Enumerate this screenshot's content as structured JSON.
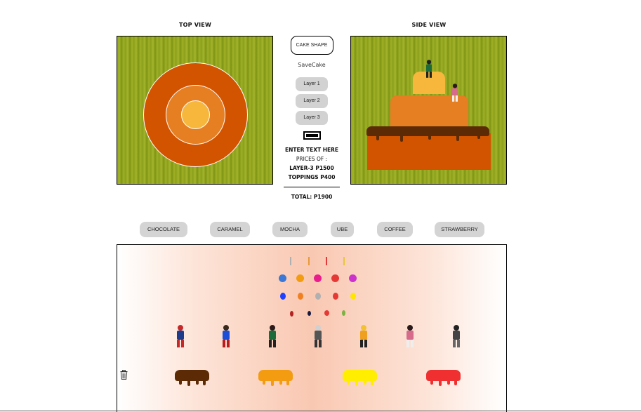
{
  "top_view": {
    "title": "TOP VIEW"
  },
  "side_view": {
    "title": "SIDE VIEW"
  },
  "controls": {
    "cake_shape_label": "CAKE SHAPE",
    "save_label": "SaveCake",
    "layers": [
      "Layer 1",
      "Layer 2",
      "Layer 3"
    ],
    "color_value": "#000000",
    "enter_text": "ENTER TEXT HERE",
    "prices_of": "PRICES OF :",
    "layer_price": "LAYER-3 P1500",
    "toppings_price": "TOPPINGS P400",
    "total": "TOTAL: P1900"
  },
  "flavors": [
    "CHOCOLATE",
    "CARAMEL",
    "MOCHA",
    "UBE",
    "COFFEE",
    "STRAWBERRY"
  ],
  "colors": {
    "layer_dark": "#d35400",
    "layer_mid": "#e67e22",
    "layer_light": "#f6b73c",
    "chocolate": "#5c2a05",
    "caramel": "#f39c12",
    "mocha_yellow": "#ffee00",
    "strawberry": "#f03030"
  },
  "palette": {
    "candle_colors": [
      "#b0b0b0",
      "#e69a3a",
      "#e03a3a",
      "#e6c83a"
    ],
    "flower_colors": [
      "#3c78d8",
      "#f39c12",
      "#e91e8c",
      "#e53935",
      "#cc33cc"
    ],
    "gem_colors": [
      "#1e40ff",
      "#f08020",
      "#b0b0b0",
      "#e53935",
      "#ffe600"
    ],
    "fruit_colors": [
      "#b22222",
      "#1a1a40",
      "#e53935",
      "#7cb342"
    ],
    "figure_names": [
      "spiderman-figure",
      "superman-figure",
      "tanjiro-figure",
      "zenitsu-hashira-figure",
      "zenitsu-figure",
      "nezuko-figure",
      "ninja-figure"
    ],
    "drip_names": [
      "chocolate-drip",
      "caramel-drip",
      "lemon-drip",
      "strawberry-drip"
    ]
  }
}
